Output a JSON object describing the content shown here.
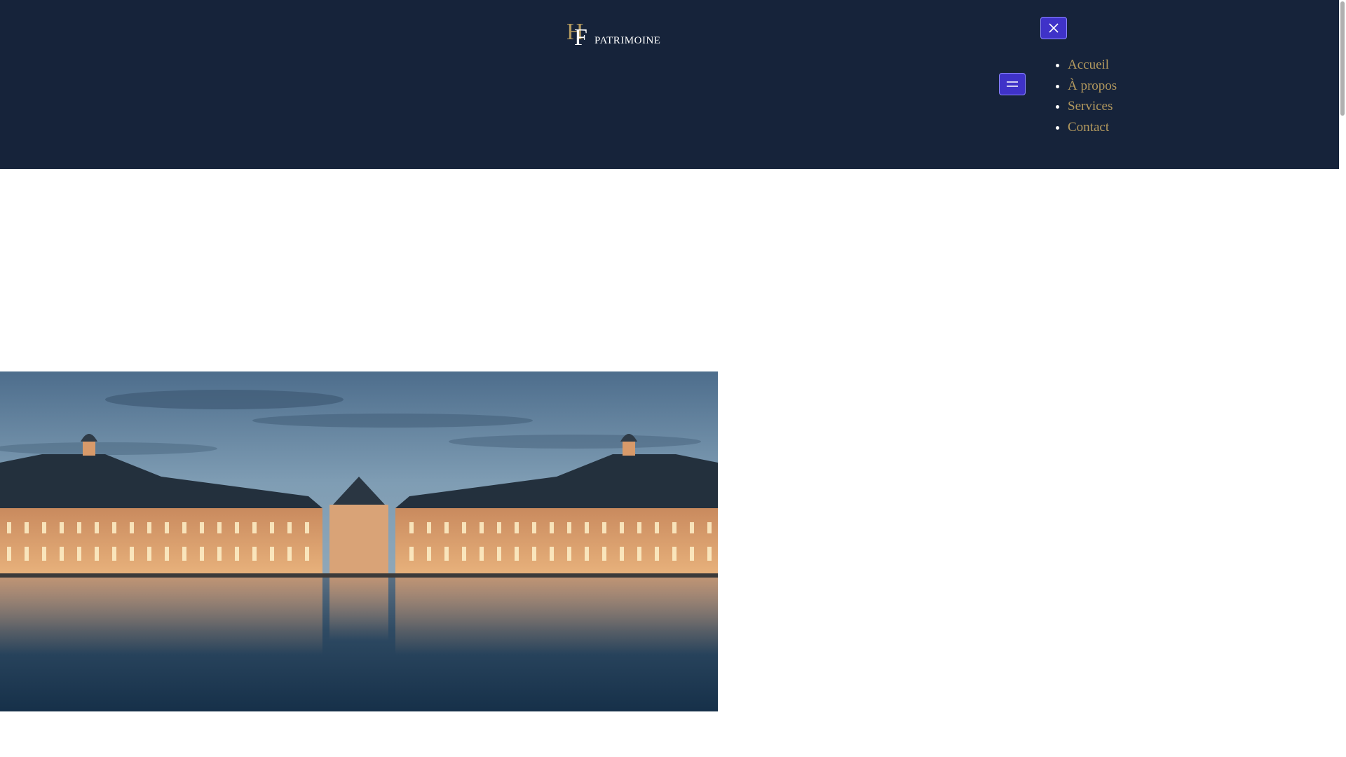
{
  "brand": {
    "monogram": "HF",
    "name": "PATRIMOINE",
    "colors": {
      "gold": "#b3995e",
      "navy": "#16233a",
      "white": "#ffffff"
    }
  },
  "header": {
    "background": "#16233a",
    "close_button": {
      "icon": "close-icon",
      "color": "#3f32c8"
    },
    "menu_button": {
      "icon": "hamburger-icon",
      "color": "#3f32c8"
    }
  },
  "nav": {
    "items": [
      {
        "label": "Accueil"
      },
      {
        "label": "À propos"
      },
      {
        "label": "Services"
      },
      {
        "label": "Contact"
      }
    ],
    "link_color": "#b3995e"
  },
  "hero": {
    "subject": "place-de-la-bourse-night-reflection"
  }
}
